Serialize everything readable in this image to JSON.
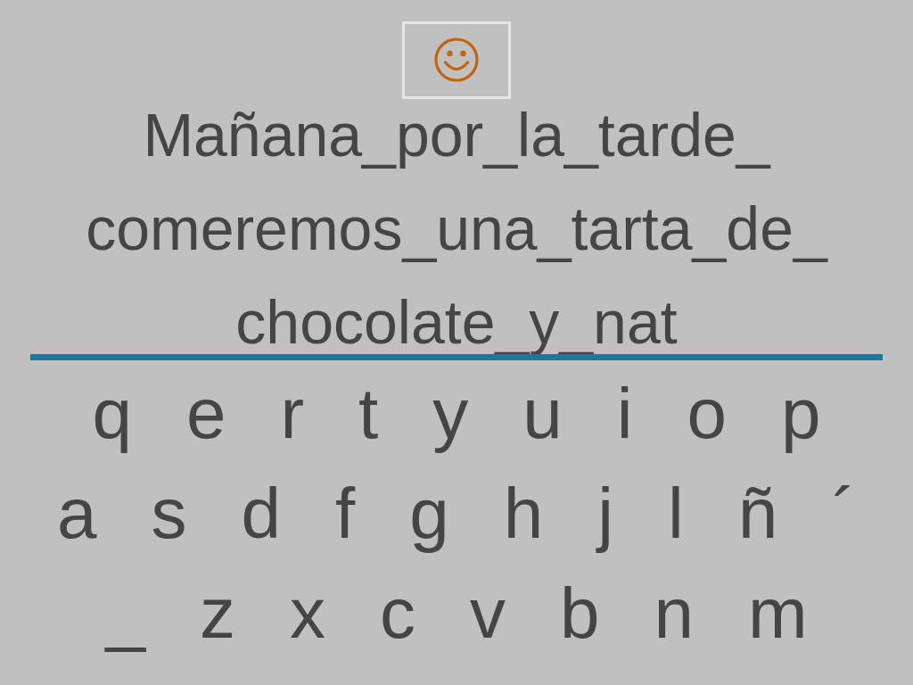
{
  "answer": {
    "lines": [
      "Mañana_por_la_tarde_",
      "comeremos_una_tarta_de_",
      "chocolate_y_nat"
    ]
  },
  "keyboard": {
    "rows": [
      [
        "q",
        "e",
        "r",
        "t",
        "y",
        "u",
        "i",
        "o",
        "p"
      ],
      [
        "a",
        "s",
        "d",
        "f",
        "g",
        "h",
        "j",
        "l",
        "ñ",
        "´"
      ],
      [
        "_",
        "z",
        "x",
        "c",
        "v",
        "b",
        "n",
        "m"
      ]
    ]
  }
}
